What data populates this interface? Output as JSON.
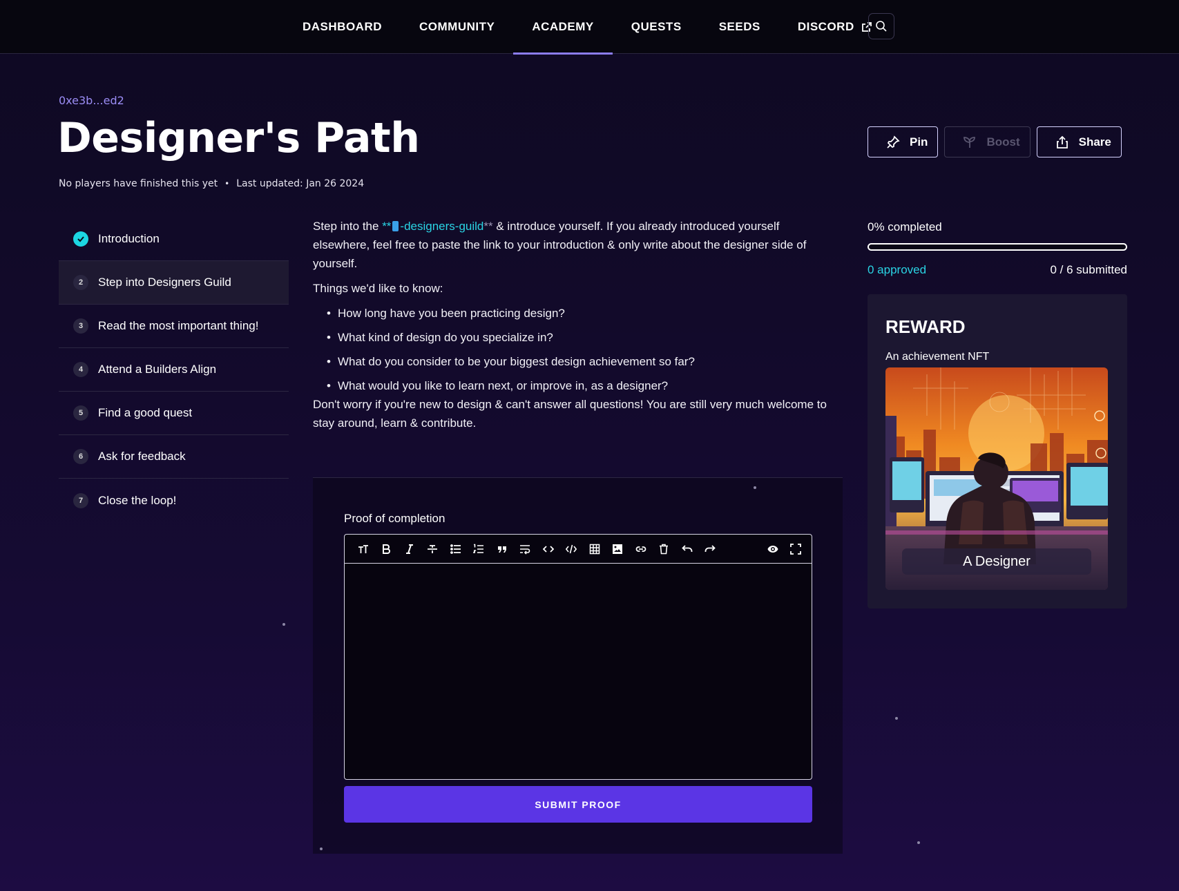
{
  "nav": {
    "items": [
      {
        "label": "DASHBOARD"
      },
      {
        "label": "COMMUNITY"
      },
      {
        "label": "ACADEMY"
      },
      {
        "label": "QUESTS"
      },
      {
        "label": "SEEDS"
      },
      {
        "label": "DISCORD"
      }
    ],
    "active": "ACADEMY"
  },
  "quest": {
    "author": "0xe3b...ed2",
    "title": "Designer's Path",
    "finished": "No players have finished this yet",
    "updated": "Last updated: Jan 26 2024"
  },
  "actions": {
    "pin": "Pin",
    "boost": "Boost",
    "share": "Share"
  },
  "steps": [
    {
      "num": "",
      "label": "Introduction",
      "done": true
    },
    {
      "num": "2",
      "label": "Step into Designers Guild"
    },
    {
      "num": "3",
      "label": "Read the most important thing!"
    },
    {
      "num": "4",
      "label": "Attend a Builders Align"
    },
    {
      "num": "5",
      "label": "Find a good quest"
    },
    {
      "num": "6",
      "label": "Ask for feedback"
    },
    {
      "num": "7",
      "label": "Close the loop!"
    }
  ],
  "content": {
    "intro_pre": "Step into the ",
    "stars_open": "**",
    "channel": "-designers-guild",
    "stars_close": "**",
    "intro_post": " & introduce yourself. If you already introduced yourself elsewhere, feel free to paste the link to your introduction & only write about the designer side of yourself.",
    "things": "Things we'd like to know:",
    "bullets": [
      "How long have you been practicing design?",
      "What kind of design do you specialize in?",
      "What do you consider to be your biggest design achievement so far?",
      "What would you like to learn next, or improve in, as a designer?"
    ],
    "outro": "Don't worry if you're new to design & can't answer all questions! You are still very much welcome to stay around, learn & contribute."
  },
  "proof": {
    "label": "Proof of completion",
    "value": "",
    "submit": "SUBMIT PROOF"
  },
  "progress": {
    "completed_label": "0% completed",
    "fraction": 0,
    "approved": "0 approved",
    "submitted": "0 / 6 submitted"
  },
  "reward": {
    "title": "REWARD",
    "subtitle": "An achievement NFT",
    "nft_name": "A Designer"
  },
  "colors": {
    "accent": "#5b35e5",
    "cyan": "#2ad4e4",
    "nav_underline": "#8b7cf0"
  }
}
